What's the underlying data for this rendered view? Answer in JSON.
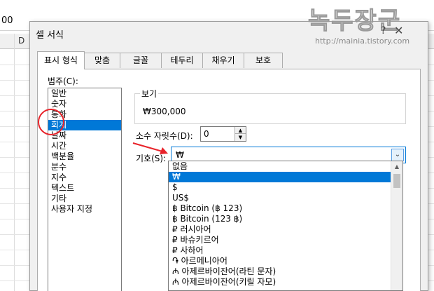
{
  "sheet": {
    "formula_value": "00",
    "column_label": "D"
  },
  "watermark": {
    "title": "녹두장군",
    "url": "http://mainia.tistory.com"
  },
  "dialog": {
    "title": "셀 서식",
    "help_glyph": "?",
    "close_glyph": "✕",
    "tabs": [
      {
        "label": "표시 형식",
        "active": true
      },
      {
        "label": "맞춤"
      },
      {
        "label": "글꼴"
      },
      {
        "label": "테두리"
      },
      {
        "label": "채우기"
      },
      {
        "label": "보호"
      }
    ],
    "category_label": "범주(C):",
    "categories": [
      "일반",
      "숫자",
      "통화",
      "회계",
      "날짜",
      "시간",
      "백분율",
      "분수",
      "지수",
      "텍스트",
      "기타",
      "사용자 지정"
    ],
    "selected_category": "회계",
    "preview_label": "보기",
    "preview_value": "₩300,000",
    "decimal_label": "소수 자릿수(D):",
    "decimal_value": "0",
    "symbol_label": "기호(S):",
    "symbol_value": "₩",
    "symbol_options": [
      "없음",
      "₩",
      "$",
      "US$",
      "฿ Bitcoin (฿ 123)",
      "฿ Bitcoin (123 ฿)",
      "₽ 러시아어",
      "₽ 바슈키르어",
      "₽ 사하어",
      "֏ 아르메니아어",
      "₼ 아제르바이잔어(라틴 문자)",
      "₼ 아제르바이잔어(키릴 자모)"
    ],
    "selected_symbol_index": 1
  },
  "colors": {
    "selection": "#0078d7",
    "annotation": "#e8232a"
  }
}
